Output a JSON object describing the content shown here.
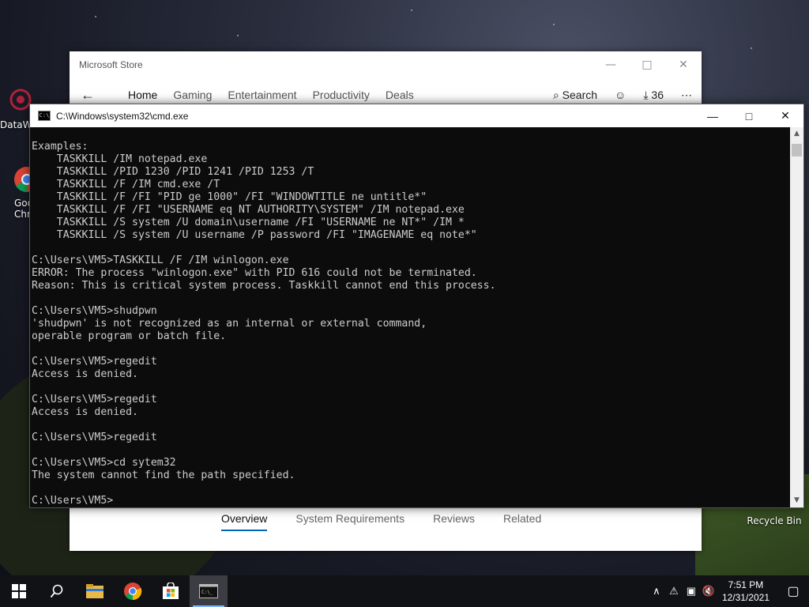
{
  "desktop": {
    "icons": [
      {
        "label": "DataW"
      },
      {
        "label": "Goo\nChr"
      },
      {
        "label": "Recycle Bin"
      }
    ]
  },
  "store": {
    "title": "Microsoft Store",
    "nav": {
      "back_icon": "back-arrow-icon",
      "tabs": [
        "Home",
        "Gaming",
        "Entertainment",
        "Productivity",
        "Deals"
      ],
      "active_tab": "Home",
      "search_label": "Search",
      "downloads_count": "36"
    },
    "bottom_tabs": [
      "Overview",
      "System Requirements",
      "Reviews",
      "Related"
    ],
    "active_bottom_tab": "Overview"
  },
  "cmd": {
    "title": "C:\\Windows\\system32\\cmd.exe",
    "lines": [
      "Examples:",
      "    TASKKILL /IM notepad.exe",
      "    TASKKILL /PID 1230 /PID 1241 /PID 1253 /T",
      "    TASKKILL /F /IM cmd.exe /T",
      "    TASKKILL /F /FI \"PID ge 1000\" /FI \"WINDOWTITLE ne untitle*\"",
      "    TASKKILL /F /FI \"USERNAME eq NT AUTHORITY\\SYSTEM\" /IM notepad.exe",
      "    TASKKILL /S system /U domain\\username /FI \"USERNAME ne NT*\" /IM *",
      "    TASKKILL /S system /U username /P password /FI \"IMAGENAME eq note*\"",
      "",
      "C:\\Users\\VM5>TASKKILL /F /IM winlogon.exe",
      "ERROR: The process \"winlogon.exe\" with PID 616 could not be terminated.",
      "Reason: This is critical system process. Taskkill cannot end this process.",
      "",
      "C:\\Users\\VM5>shudpwn",
      "'shudpwn' is not recognized as an internal or external command,",
      "operable program or batch file.",
      "",
      "C:\\Users\\VM5>regedit",
      "Access is denied.",
      "",
      "C:\\Users\\VM5>regedit",
      "Access is denied.",
      "",
      "C:\\Users\\VM5>regedit",
      "",
      "C:\\Users\\VM5>cd sytem32",
      "The system cannot find the path specified.",
      "",
      "C:\\Users\\VM5>"
    ]
  },
  "taskbar": {
    "apps": [
      "start-icon",
      "search-icon",
      "file-explorer-icon",
      "chrome-icon",
      "store-icon",
      "cmd-icon"
    ],
    "active_app": "cmd-icon",
    "clock": {
      "time": "7:51 PM",
      "date": "12/31/2021"
    }
  },
  "colors": {
    "accent": "#0067b8",
    "console_bg": "#0c0c0c",
    "console_text": "#cccccc"
  }
}
